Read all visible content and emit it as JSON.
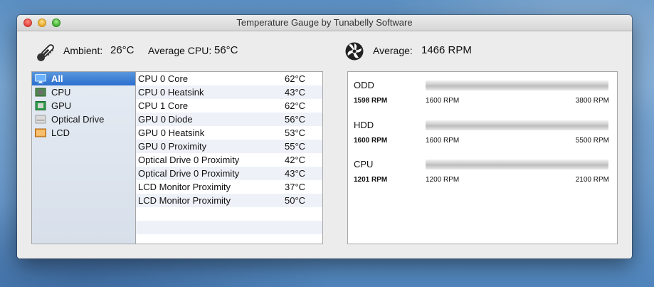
{
  "window": {
    "title": "Temperature Gauge by Tunabelly Software"
  },
  "summary": {
    "ambient_label": "Ambient:",
    "ambient_value": "26°C",
    "avg_cpu_label": "Average CPU:",
    "avg_cpu_value": "56°C",
    "avg_fan_label": "Average:",
    "avg_fan_value": "1466 RPM",
    "thermometer_icon": "thermometer-icon",
    "fan_icon": "fan-icon"
  },
  "sidebar": {
    "items": [
      {
        "label": "All",
        "icon": "monitor-icon",
        "selected": true
      },
      {
        "label": "CPU",
        "icon": "cpu-chip-icon",
        "selected": false
      },
      {
        "label": "GPU",
        "icon": "gpu-chip-icon",
        "selected": false
      },
      {
        "label": "Optical Drive",
        "icon": "optical-drive-icon",
        "selected": false
      },
      {
        "label": "LCD",
        "icon": "lcd-icon",
        "selected": false
      }
    ]
  },
  "sensors": [
    {
      "name": "CPU 0 Core",
      "value": "62°C"
    },
    {
      "name": "CPU 0 Heatsink",
      "value": "43°C"
    },
    {
      "name": "CPU 1 Core",
      "value": "62°C"
    },
    {
      "name": "GPU 0 Diode",
      "value": "56°C"
    },
    {
      "name": "GPU 0 Heatsink",
      "value": "53°C"
    },
    {
      "name": "GPU 0 Proximity",
      "value": "55°C"
    },
    {
      "name": "Optical Drive 0 Proximity",
      "value": "42°C"
    },
    {
      "name": "Optical Drive 0 Proximity",
      "value": "43°C"
    },
    {
      "name": "LCD Monitor Proximity",
      "value": "37°C"
    },
    {
      "name": "LCD Monitor Proximity",
      "value": "50°C"
    }
  ],
  "fans": [
    {
      "name": "ODD",
      "rpm": "1598 RPM",
      "min": "1600 RPM",
      "max": "3800 RPM",
      "level": 0
    },
    {
      "name": "HDD",
      "rpm": "1600 RPM",
      "min": "1600 RPM",
      "max": "5500 RPM",
      "level": 0
    },
    {
      "name": "CPU",
      "rpm": "1201 RPM",
      "min": "1200 RPM",
      "max": "2100 RPM",
      "level": 0
    }
  ],
  "colors": {
    "selection": "#2a6fcf",
    "alt_row": "#eef2f8",
    "sidebar_bg": "#dde4ee"
  }
}
